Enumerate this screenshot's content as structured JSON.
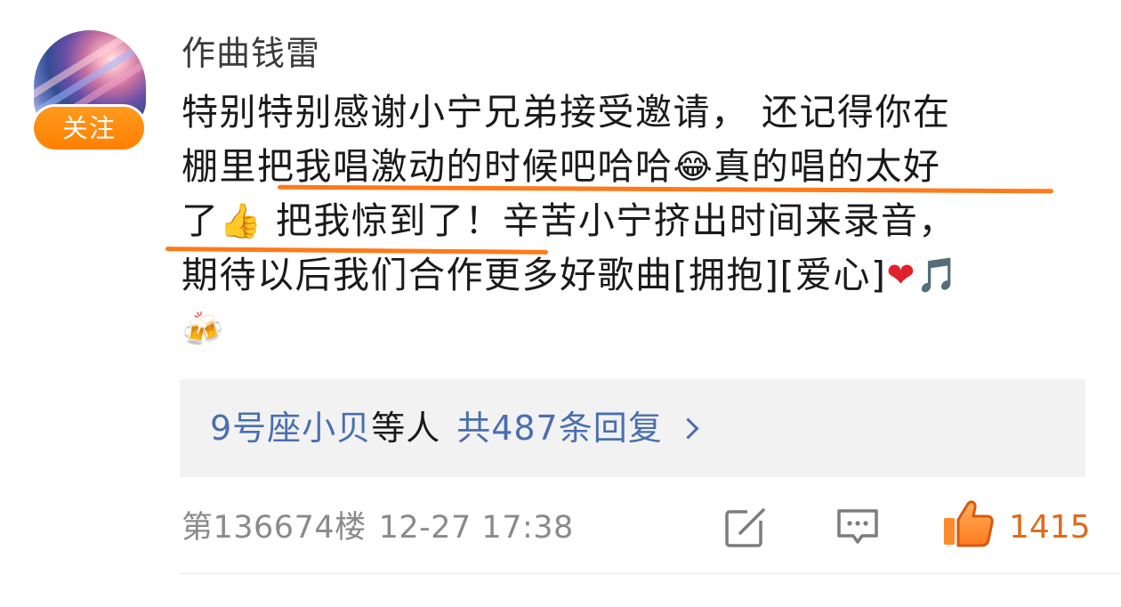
{
  "user": {
    "name": "作曲钱雷",
    "follow_label": "关注"
  },
  "comment": {
    "line1": "特别特别感谢小宁兄弟接受邀请， 还记得你在",
    "line2_a": "棚里把我唱激动的时候吧哈哈",
    "line2_emoji": "😂",
    "line2_b": "真的唱的太好",
    "line3_a": "了",
    "line3_emoji": "👍",
    "line3_b": " 把我惊到了！辛苦小宁挤出时间来录音，",
    "line4_a": "期待以后我们合作更多好歌曲[拥抱][爱心]",
    "line4_heart": "❤",
    "line4_note": "🎵",
    "line5_emoji": "🍻"
  },
  "replies": {
    "user": "9号座小贝",
    "etc": "等人",
    "count_label": "共487条回复"
  },
  "footer": {
    "floor": "第136674楼",
    "date": "12-27 17:38",
    "like_count": "1415"
  },
  "colors": {
    "accent_orange": "#ff7f00",
    "link_blue": "#4a6fae",
    "like_orange": "#e06a1a",
    "underline": "#ff7a1a"
  }
}
